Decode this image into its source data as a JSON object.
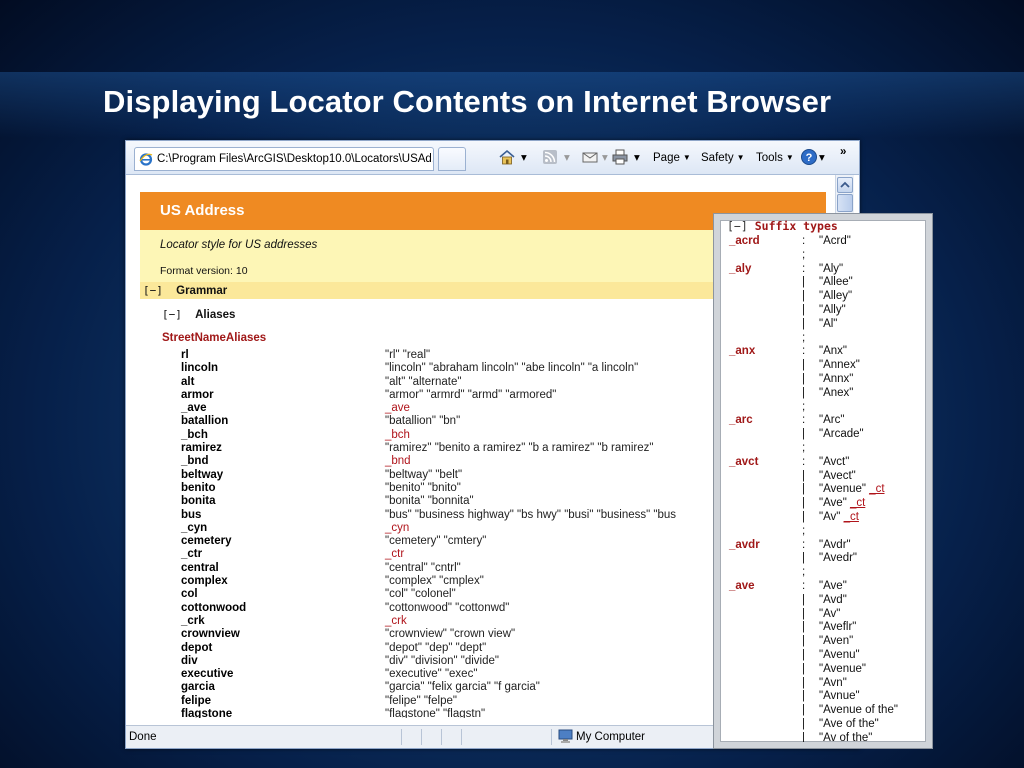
{
  "slide": {
    "title": "Displaying Locator Contents on Internet Browser"
  },
  "browser": {
    "tab_title": "C:\\Program Files\\ArcGIS\\Desktop10.0\\Locators\\USAd...",
    "toolbar": {
      "page_label": "Page",
      "safety_label": "Safety",
      "tools_label": "Tools",
      "overflow": "»"
    },
    "status": {
      "left": "Done",
      "zone": "My Computer"
    }
  },
  "locator": {
    "header_title": "US Address",
    "description": "Locator style for US addresses",
    "format_version": "Format version: 10",
    "grammar_toggle": "[−]",
    "grammar_label": "Grammar",
    "aliases_toggle": "[−]",
    "aliases_label": "Aliases",
    "section_title": "StreetNameAliases",
    "aliases": [
      {
        "key": "rl",
        "value": "\"rl\" \"real\"",
        "ref": false
      },
      {
        "key": "lincoln",
        "value": "\"lincoln\" \"abraham lincoln\" \"abe lincoln\" \"a lincoln\"",
        "ref": false
      },
      {
        "key": "alt",
        "value": "\"alt\" \"alternate\"",
        "ref": false
      },
      {
        "key": "armor",
        "value": "\"armor\" \"armrd\" \"armd\" \"armored\"",
        "ref": false
      },
      {
        "key": "_ave",
        "value": "_ave",
        "ref": true
      },
      {
        "key": "batallion",
        "value": "\"batallion\" \"bn\"",
        "ref": false
      },
      {
        "key": "_bch",
        "value": "_bch",
        "ref": true
      },
      {
        "key": "ramirez",
        "value": "\"ramirez\" \"benito a ramirez\" \"b a ramirez\" \"b ramirez\"",
        "ref": false
      },
      {
        "key": "_bnd",
        "value": "_bnd",
        "ref": true
      },
      {
        "key": "beltway",
        "value": "\"beltway\" \"belt\"",
        "ref": false
      },
      {
        "key": "benito",
        "value": "\"benito\" \"bnito\"",
        "ref": false
      },
      {
        "key": "bonita",
        "value": "\"bonita\" \"bonnita\"",
        "ref": false
      },
      {
        "key": "bus",
        "value": "\"bus\" \"business highway\" \"bs hwy\" \"busi\" \"business\" \"bus",
        "ref": false
      },
      {
        "key": "_cyn",
        "value": "_cyn",
        "ref": true
      },
      {
        "key": "cemetery",
        "value": "\"cemetery\" \"cmtery\"",
        "ref": false
      },
      {
        "key": "_ctr",
        "value": "_ctr",
        "ref": true
      },
      {
        "key": "central",
        "value": "\"central\" \"cntrl\"",
        "ref": false
      },
      {
        "key": "complex",
        "value": "\"complex\" \"cmplex\"",
        "ref": false
      },
      {
        "key": "col",
        "value": "\"col\" \"colonel\"",
        "ref": false
      },
      {
        "key": "cottonwood",
        "value": "\"cottonwood\" \"cottonwd\"",
        "ref": false
      },
      {
        "key": "_crk",
        "value": "_crk",
        "ref": true
      },
      {
        "key": "crownview",
        "value": "\"crownview\" \"crown view\"",
        "ref": false
      },
      {
        "key": "depot",
        "value": "\"depot\" \"dep\" \"dept\"",
        "ref": false
      },
      {
        "key": "div",
        "value": "\"div\" \"division\" \"divide\"",
        "ref": false
      },
      {
        "key": "executive",
        "value": "\"executive\" \"exec\"",
        "ref": false
      },
      {
        "key": "garcia",
        "value": "\"garcia\" \"felix garcia\" \"f garcia\"",
        "ref": false
      },
      {
        "key": "felipe",
        "value": "\"felipe\" \"felpe\"",
        "ref": false
      },
      {
        "key": "flagstone",
        "value": "\"flagstone\" \"flagstn\"",
        "ref": false
      }
    ]
  },
  "suffix_popup": {
    "toggle": "[−]",
    "title": "Suffix types",
    "lines": [
      {
        "k": "_acrd",
        "s": ":",
        "v": "\"Acrd\""
      },
      {
        "k": "",
        "s": ";",
        "v": ""
      },
      {
        "k": "_aly",
        "s": ":",
        "v": "\"Aly\""
      },
      {
        "k": "",
        "s": "|",
        "v": "\"Allee\""
      },
      {
        "k": "",
        "s": "|",
        "v": "\"Alley\""
      },
      {
        "k": "",
        "s": "|",
        "v": "\"Ally\""
      },
      {
        "k": "",
        "s": "|",
        "v": "\"Al\""
      },
      {
        "k": "",
        "s": ";",
        "v": ""
      },
      {
        "k": "_anx",
        "s": ":",
        "v": "\"Anx\""
      },
      {
        "k": "",
        "s": "|",
        "v": "\"Annex\""
      },
      {
        "k": "",
        "s": "|",
        "v": "\"Annx\""
      },
      {
        "k": "",
        "s": "|",
        "v": "\"Anex\""
      },
      {
        "k": "",
        "s": ";",
        "v": ""
      },
      {
        "k": "_arc",
        "s": ":",
        "v": "\"Arc\""
      },
      {
        "k": "",
        "s": "|",
        "v": "\"Arcade\""
      },
      {
        "k": "",
        "s": ";",
        "v": ""
      },
      {
        "k": "_avct",
        "s": ":",
        "v": "\"Avct\""
      },
      {
        "k": "",
        "s": "|",
        "v": "\"Avect\""
      },
      {
        "k": "",
        "s": "|",
        "v": "\"Avenue\"",
        "ref": "_ct"
      },
      {
        "k": "",
        "s": "|",
        "v": "\"Ave\"",
        "ref": "_ct"
      },
      {
        "k": "",
        "s": "|",
        "v": "\"Av\"",
        "ref": "_ct"
      },
      {
        "k": "",
        "s": ";",
        "v": ""
      },
      {
        "k": "_avdr",
        "s": ":",
        "v": "\"Avdr\""
      },
      {
        "k": "",
        "s": "|",
        "v": "\"Avedr\""
      },
      {
        "k": "",
        "s": ";",
        "v": ""
      },
      {
        "k": "_ave",
        "s": ":",
        "v": "\"Ave\""
      },
      {
        "k": "",
        "s": "|",
        "v": "\"Avd\""
      },
      {
        "k": "",
        "s": "|",
        "v": "\"Av\""
      },
      {
        "k": "",
        "s": "|",
        "v": "\"Aveflr\""
      },
      {
        "k": "",
        "s": "|",
        "v": "\"Aven\""
      },
      {
        "k": "",
        "s": "|",
        "v": "\"Avenu\""
      },
      {
        "k": "",
        "s": "|",
        "v": "\"Avenue\""
      },
      {
        "k": "",
        "s": "|",
        "v": "\"Avn\""
      },
      {
        "k": "",
        "s": "|",
        "v": "\"Avnue\""
      },
      {
        "k": "",
        "s": "|",
        "v": "\"Avenue of the\""
      },
      {
        "k": "",
        "s": "|",
        "v": "\"Ave of the\""
      },
      {
        "k": "",
        "s": "|",
        "v": "\"Av of the\""
      }
    ]
  },
  "colors": {
    "header_orange": "#ef8a22",
    "desc_yellow": "#fdf6b6",
    "grammar_yellow": "#fbe89a",
    "key_red": "#a01818"
  }
}
